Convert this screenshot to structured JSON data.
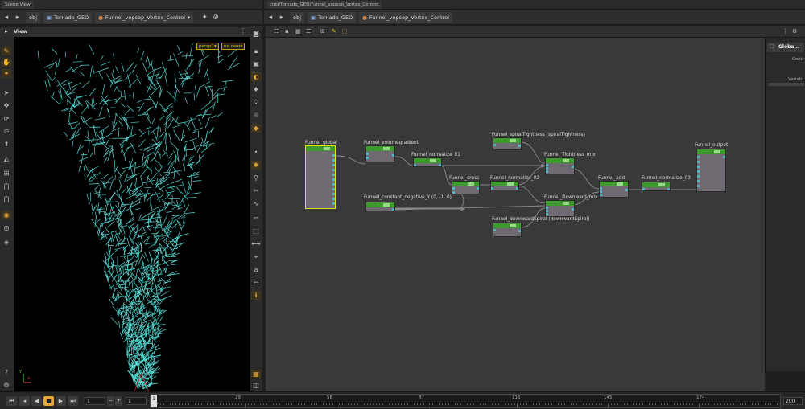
{
  "left_pane": {
    "tab_label": "Scene View",
    "path": {
      "obj": "obj",
      "geo": "Tornado_GEO",
      "node": "Funnel_vopsop_Vortex_Control"
    },
    "view_label": "View",
    "camera_dropdown": "persp1",
    "cam_dropdown": "no cam",
    "axis_x": "x",
    "axis_y": "y"
  },
  "right_pane": {
    "tab_label": "/obj/Tornado_GEO/Funnel_vopsop_Vortex_Control",
    "path": {
      "obj": "obj",
      "geo": "Tornado_GEO",
      "node": "Funnel_vopsop_Vortex_Control"
    },
    "panel_title": "Globa...",
    "panel_label_1": "Contr",
    "panel_label_2": "Variabl"
  },
  "nodes": [
    {
      "id": "global",
      "label": "Funnel_global"
    },
    {
      "id": "volumegradient",
      "label": "Funnel_volumegradient"
    },
    {
      "id": "normalize01",
      "label": "Funnel_normalize_01"
    },
    {
      "id": "cross",
      "label": "Funnel_cross"
    },
    {
      "id": "normalize02",
      "label": "Funnel_normalize_02"
    },
    {
      "id": "constant",
      "label": "Funnel_constant_negative_Y (0, -1, 0)"
    },
    {
      "id": "spiral",
      "label": "Funnel_spiralTightness (spiralTightness)"
    },
    {
      "id": "tightmix",
      "label": "Funnel_Tightness_mix"
    },
    {
      "id": "downmix",
      "label": "Funnel_Downward_mix"
    },
    {
      "id": "downspiral",
      "label": "Funnel_downwardSpiral (downwardSpiral)"
    },
    {
      "id": "add",
      "label": "Funnel_add"
    },
    {
      "id": "normalize03",
      "label": "Funnel_normalize_03"
    },
    {
      "id": "output",
      "label": "Funnel_output"
    }
  ],
  "timeline": {
    "current_frame": "1",
    "start_frame": "1",
    "end_frame": "200",
    "ruler_start": "1",
    "ticks": [
      "29",
      "58",
      "87",
      "116",
      "145",
      "174"
    ],
    "step_minus": "−",
    "step_plus": "+"
  },
  "icons": {
    "back": "◂",
    "fwd": "▸",
    "play": "▶",
    "stop": "■",
    "rev": "◀",
    "first": "⏮",
    "last": "⏭"
  }
}
